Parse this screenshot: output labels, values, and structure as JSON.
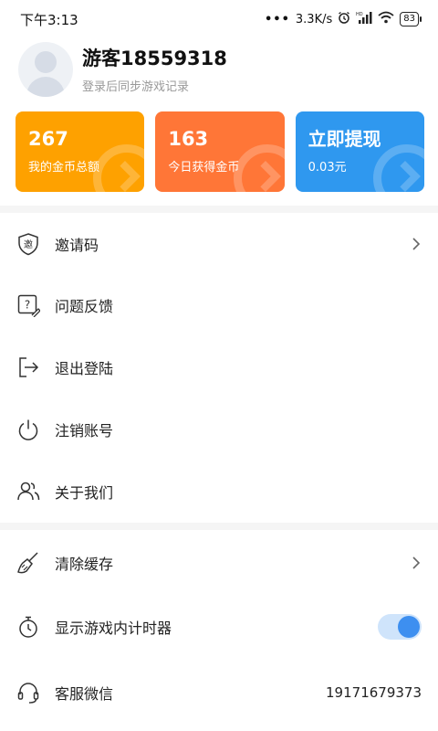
{
  "status_bar": {
    "time": "下午3:13",
    "network_speed": "3.3K/s",
    "battery": "83"
  },
  "profile": {
    "username": "游客18559318",
    "subtitle": "登录后同步游戏记录"
  },
  "cards": [
    {
      "value": "267",
      "label": "我的金币总额",
      "color": "#fea100"
    },
    {
      "value": "163",
      "label": "今日获得金币",
      "color": "#ff7637"
    },
    {
      "value": "立即提现",
      "label": "0.03元",
      "color": "#2f98ef"
    }
  ],
  "menu": {
    "invite_code": "邀请码",
    "feedback": "问题反馈",
    "logout": "退出登陆",
    "cancel_account": "注销账号",
    "about_us": "关于我们",
    "clear_cache": "清除缓存",
    "show_timer": "显示游戏内计时器",
    "service_wechat": "客服微信",
    "service_wechat_value": "19171679373"
  },
  "timer_toggle_on": true,
  "accent_color": "#3d8ff0"
}
